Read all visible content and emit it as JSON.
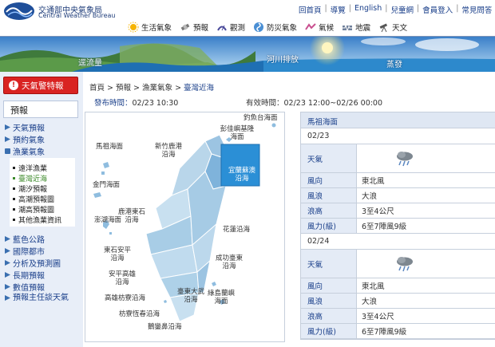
{
  "header": {
    "org_name_zh": "交通部中央氣象局",
    "org_name_en": "Central Weather Bureau",
    "top_links": [
      "回首頁",
      "導覽",
      "English",
      "兒童網",
      "會員登入",
      "常見問答"
    ],
    "nav": [
      {
        "label": "生活氣象",
        "icon": "sun-icon"
      },
      {
        "label": "預報",
        "icon": "satellite-icon"
      },
      {
        "label": "觀測",
        "icon": "radar-icon"
      },
      {
        "label": "防災氣象",
        "icon": "typhoon-icon"
      },
      {
        "label": "氣候",
        "icon": "climate-icon"
      },
      {
        "label": "地震",
        "icon": "seismograph-icon"
      },
      {
        "label": "天文",
        "icon": "telescope-icon"
      }
    ],
    "banner_labels": [
      "逕流量",
      "河川排放",
      "蒸發"
    ]
  },
  "sidebar": {
    "alert_label": "天氣警特報",
    "section_title": "預報",
    "items_top": [
      "天氣預報",
      "預約氣象",
      "漁業氣象"
    ],
    "sub_items": [
      "遠洋漁業",
      "臺灣近海",
      "潮汐預報",
      "高潮預報圖",
      "潮高預報圖",
      "其他漁業資訊"
    ],
    "active_sub": "臺灣近海",
    "items_bottom": [
      "藍色公路",
      "國際都市",
      "分析及預測圖",
      "長期預報",
      "數值預報",
      "預報主任談天氣"
    ]
  },
  "breadcrumb": [
    "首頁",
    "預報",
    "漁業氣象",
    "臺灣近海"
  ],
  "times": {
    "issue_label": "發布時間：",
    "issue_value": "02/23 10:30",
    "valid_label": "有效時間：",
    "valid_value": "02/23 12:00~02/26 00:00"
  },
  "map": {
    "zones": [
      "釣魚台海面",
      "彭佳嶼基隆海面",
      "馬祖海面",
      "新竹鹿港沿海",
      "宜蘭蘇澳沿海",
      "金門海面",
      "鹿港東石沿海",
      "澎湖海面",
      "東石安平沿海",
      "花蓮沿海",
      "安平高雄沿海",
      "成功臺東沿海",
      "高雄枋寮沿海",
      "臺東大武沿海",
      "綠島蘭嶼海面",
      "枋寮恆春沿海",
      "鵝鑾鼻沿海"
    ],
    "highlighted_zone": "宜蘭蘇澳沿海"
  },
  "forecast": {
    "region": "馬祖海面",
    "days": [
      {
        "date": "02/23",
        "weather_label": "天氣",
        "weather_icon": "rain-cloud-icon",
        "rows": [
          {
            "k": "風向",
            "v": "東北風"
          },
          {
            "k": "風浪",
            "v": "大浪"
          },
          {
            "k": "浪高",
            "v": "3至4公尺"
          },
          {
            "k": "風力(級)",
            "v": "6至7陣風9級"
          }
        ]
      },
      {
        "date": "02/24",
        "weather_label": "天氣",
        "weather_icon": "rain-cloud-icon",
        "rows": [
          {
            "k": "風向",
            "v": "東北風"
          },
          {
            "k": "風浪",
            "v": "大浪"
          },
          {
            "k": "浪高",
            "v": "3至4公尺"
          },
          {
            "k": "風力(級)",
            "v": "6至7陣風9級"
          }
        ]
      }
    ]
  },
  "colors": {
    "sea_zone_fill": "#b9d6ea",
    "highlight_fill": "#2b8fd6",
    "alert_red": "#d92322",
    "link_blue": "#1a3f8a"
  }
}
